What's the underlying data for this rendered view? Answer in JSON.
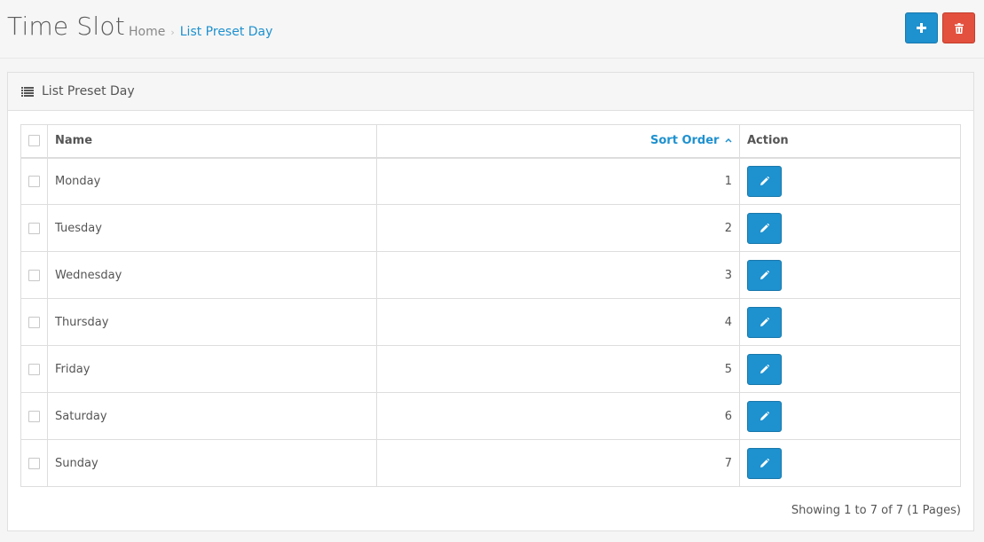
{
  "header": {
    "title": "Time Slot",
    "breadcrumb": {
      "home": "Home",
      "separator": "›",
      "current": "List Preset Day"
    },
    "add_icon": "plus-icon",
    "delete_icon": "trash-icon"
  },
  "panel": {
    "icon": "list-icon",
    "title": "List Preset Day"
  },
  "table": {
    "columns": {
      "name": "Name",
      "sort_order": "Sort Order",
      "action": "Action"
    },
    "sort_indicator": "caret-up",
    "rows": [
      {
        "name": "Monday",
        "sort_order": "1"
      },
      {
        "name": "Tuesday",
        "sort_order": "2"
      },
      {
        "name": "Wednesday",
        "sort_order": "3"
      },
      {
        "name": "Thursday",
        "sort_order": "4"
      },
      {
        "name": "Friday",
        "sort_order": "5"
      },
      {
        "name": "Saturday",
        "sort_order": "6"
      },
      {
        "name": "Sunday",
        "sort_order": "7"
      }
    ],
    "edit_icon": "pencil-icon"
  },
  "pagination": {
    "summary": "Showing 1 to 7 of 7 (1 Pages)"
  },
  "colors": {
    "primary": "#1e91cf",
    "danger": "#e3503e"
  }
}
